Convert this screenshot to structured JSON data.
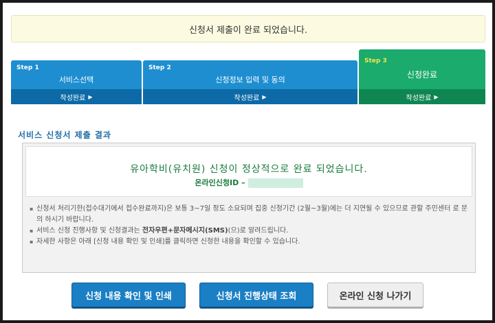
{
  "notice": {
    "text": "신청서 제출이 완료 되었습니다."
  },
  "steps": [
    {
      "label": "Step 1",
      "title": "서비스선택",
      "status": "작성완료"
    },
    {
      "label": "Step 2",
      "title": "신청정보 입력 및 동의",
      "status": "작성완료"
    },
    {
      "label": "Step 3",
      "title": "신청완료",
      "status": "작성완료"
    }
  ],
  "section": {
    "title": "서비스 신청서 제출 결과"
  },
  "result": {
    "message": "유아학비(유치원) 신청이 정상적으로 완료 되었습니다.",
    "id_label": "온라인신청ID –"
  },
  "notes": [
    "신청서 처리기한(접수대기에서 접수완료까지)은 보통 3~7일 정도 소요되며 집중 신청기간 (2월~3월)에는 더 지연될 수 있으므로 관할 주민센터 로 문의 하시기 바랍니다.",
    {
      "pre": "서비스 신청 진행사항 및 신청결과는 ",
      "bold": "전자우편+문자메시지(SMS)",
      "post": "(으)로 알려드립니다."
    },
    "자세한 사항은 아래 [신청 내용 확인 및 인쇄]를 클릭하면 신청한 내용을 확인할 수 있습니다."
  ],
  "buttons": {
    "print": "신청 내용 확인 및 인쇄",
    "status": "신청서 진행상태 조회",
    "exit": "온라인 신청 나가기"
  },
  "colors": {
    "step_blue": "#1e8ed0",
    "step_green": "#1aab6d",
    "result_green": "#197a3a",
    "button_blue": "#1a7fc4"
  }
}
